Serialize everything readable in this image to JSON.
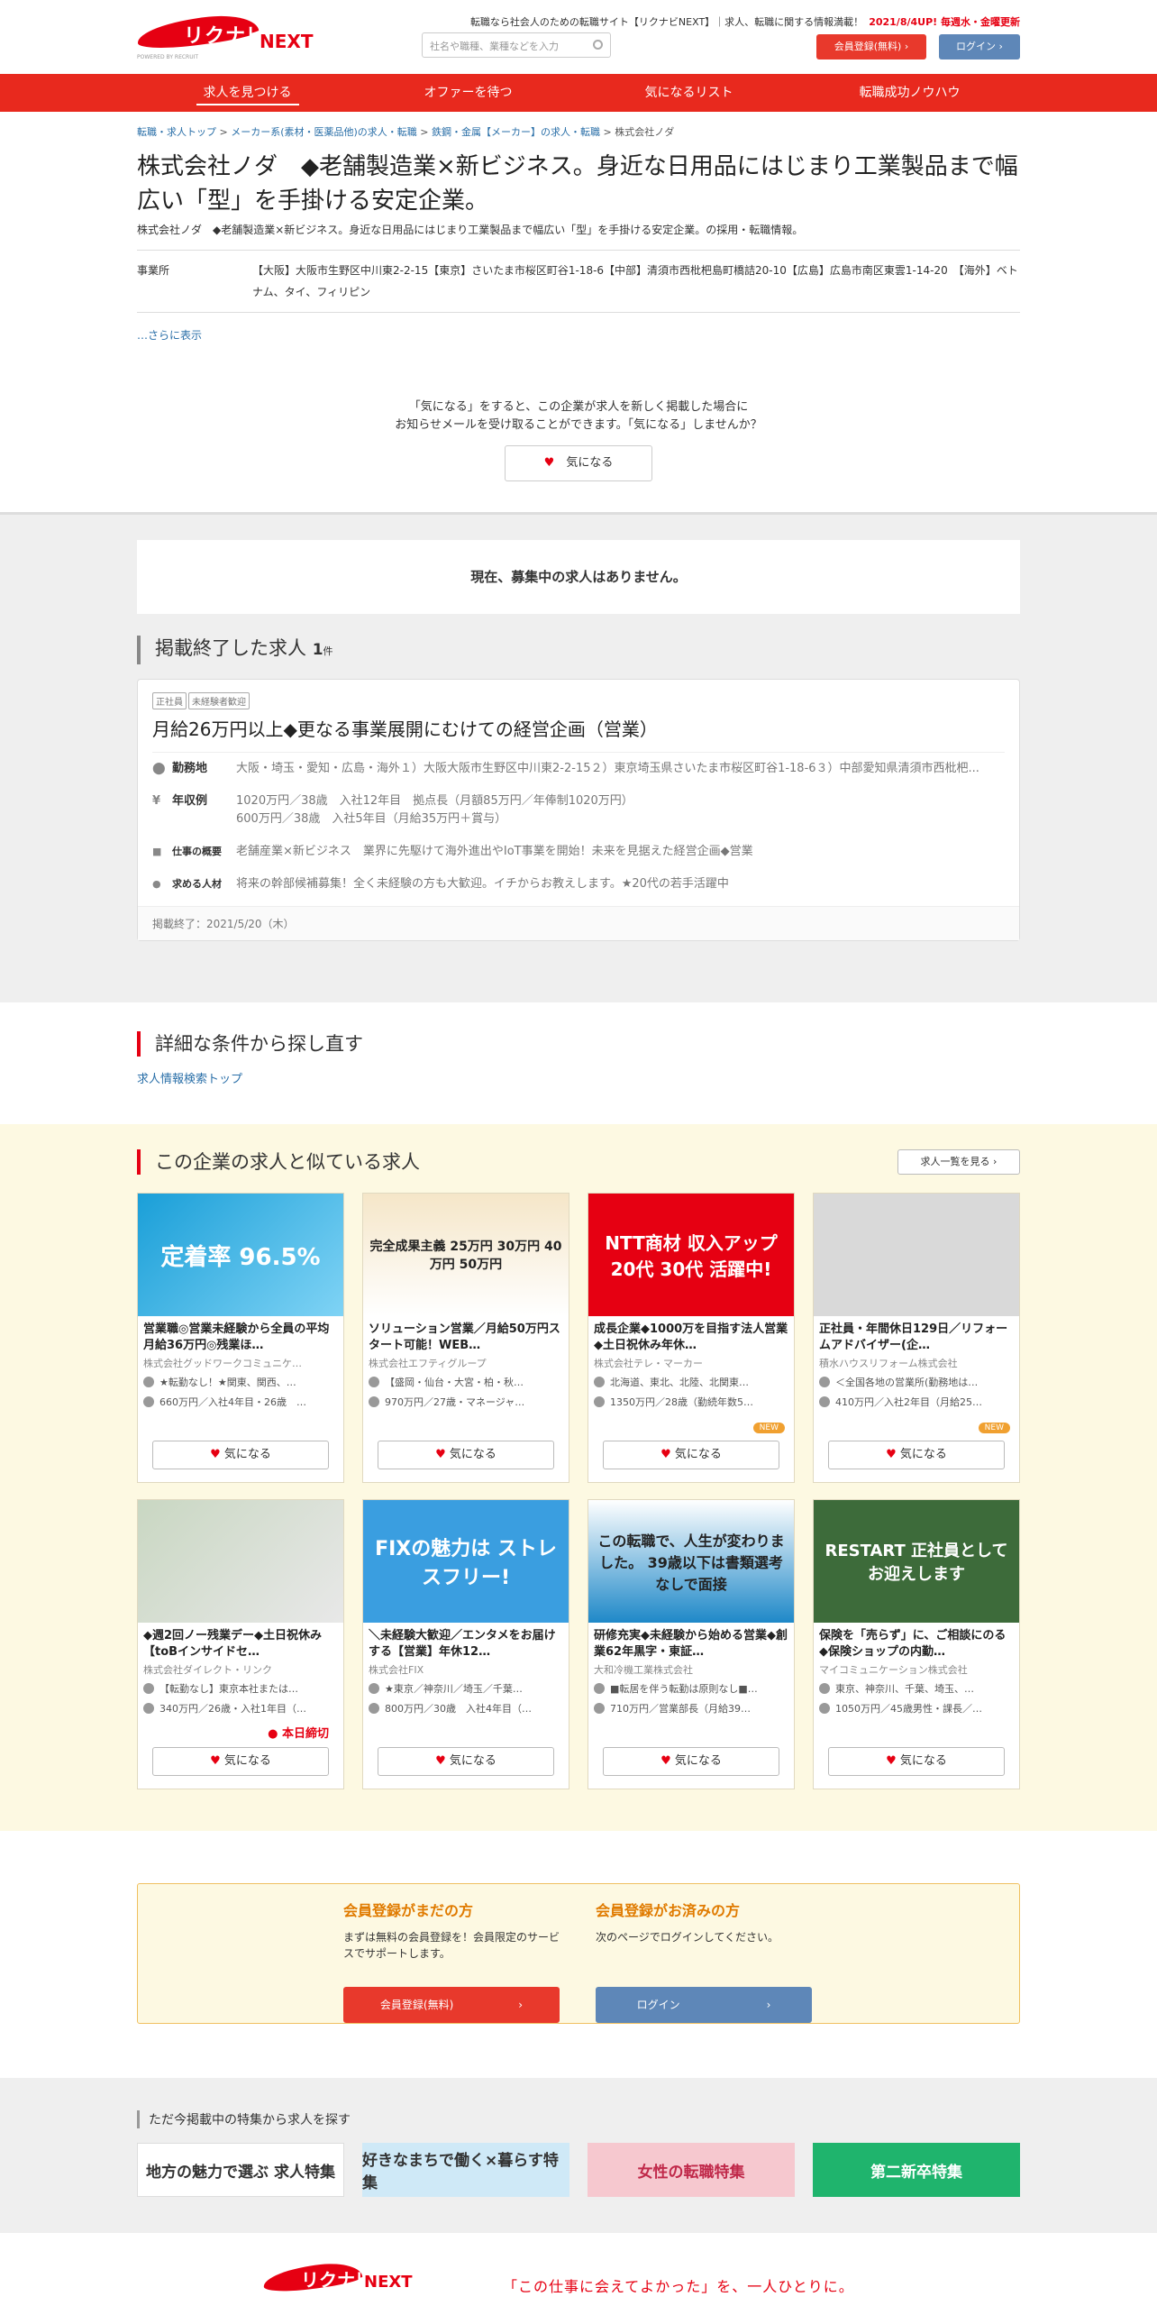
{
  "header": {
    "logo_main": "リクナビ",
    "logo_next": "NEXT",
    "powered": "POWERED BY RECRUIT",
    "tagline": "転職なら社会人のための転職サイト【リクナビNEXT】｜求人、転職に関する情報満載！",
    "update": "2021/8/4UP! 毎週水・金曜更新",
    "search_placeholder": "社名や職種、業種などを入力",
    "register": "会員登録(無料)",
    "login": "ログイン"
  },
  "nav": [
    "求人を見つける",
    "オファーを待つ",
    "気になるリスト",
    "転職成功ノウハウ"
  ],
  "breadcrumb": [
    "転職・求人トップ",
    "メーカー系(素材・医薬品他)の求人・転職",
    "鉄鋼・金属【メーカー】の求人・転職",
    "株式会社ノダ"
  ],
  "company": {
    "title": "株式会社ノダ　◆老舗製造業×新ビジネス。身近な日用品にはじまり工業製品まで幅広い「型」を手掛ける安定企業。",
    "subtitle": "株式会社ノダ　◆老舗製造業×新ビジネス。身近な日用品にはじまり工業製品まで幅広い「型」を手掛ける安定企業。の採用・転職情報。",
    "office_label": "事業所",
    "office": "【大阪】大阪市生野区中川東2-2-15【東京】さいたま市桜区町谷1-18-6【中部】清須市西枇杷島町橋詰20-10【広島】広島市南区東雲1-14-20　【海外】ベトナム、タイ、フィリピン",
    "more": "…さらに表示"
  },
  "follow": {
    "line1": "「気になる」をすると、この企業が求人を新しく掲載した場合に",
    "line2": "お知らせメールを受け取ることができます。「気になる」しませんか？",
    "button": "気になる"
  },
  "nojob": "現在、募集中の求人はありません。",
  "ended": {
    "heading": "掲載終了した求人",
    "count": "1",
    "unit": "件",
    "badges": [
      "正社員",
      "未経験者歓迎"
    ],
    "title": "月給26万円以上◆更なる事業展開にむけての経営企画（営業）",
    "rows": [
      {
        "label": "勤務地",
        "value": "大阪・埼玉・愛知・広島・海外１）大阪大阪市生野区中川東2-2-15２）東京埼玉県さいたま市桜区町谷1-18-6３）中部愛知県清須市西枇杷..."
      },
      {
        "label": "年収例",
        "value": "1020万円／38歳　入社12年目　拠点長（月額85万円／年俸制1020万円）\n600万円／38歳　入社5年目（月給35万円＋賞与）"
      },
      {
        "label": "仕事の概要",
        "value": "老舗産業×新ビジネス　業界に先駆けて海外進出やIoT事業を開始！未来を見据えた経営企画◆営業"
      },
      {
        "label": "求める人材",
        "value": "将来の幹部候補募集！全く未経験の方も大歓迎。イチからお教えします。★20代の若手活躍中"
      }
    ],
    "end": "掲載終了：2021/5/20（木）"
  },
  "detail": {
    "heading": "詳細な条件から探し直す",
    "link": "求人情報検索トップ"
  },
  "similar": {
    "heading": "この企業の求人と似ている求人",
    "all": "求人一覧を見る",
    "fav": "気になる",
    "jobs": [
      {
        "img": "定着率 96.5%",
        "title": "営業職◎営業未経験から全員の平均月給36万円◎残業ほ…",
        "company": "株式会社グッドワークコミュニケ…",
        "loc": "★転勤なし！★関東、関西、…",
        "sal": "660万円／入社4年目・26歳　…",
        "new": "",
        "tag": ""
      },
      {
        "img": "完全成果主義 25万円 30万円 40万円 50万円",
        "title": "ソリューション営業／月給50万円スタート可能！WEB…",
        "company": "株式会社エフティグループ",
        "loc": "【盛岡・仙台・大宮・柏・秋…",
        "sal": "970万円／27歳・マネージャ…",
        "new": "",
        "tag": ""
      },
      {
        "img": "NTT商材 収入アップ 20代 30代 活躍中!",
        "title": "成長企業◆1000万を目指す法人営業◆土日祝休み年休…",
        "company": "株式会社テレ・マーカー",
        "loc": "北海道、東北、北陸、北関東…",
        "sal": "1350万円／28歳（勤続年数5…",
        "new": "NEW",
        "tag": ""
      },
      {
        "img": "",
        "title": "正社員・年間休日129日／リフォームアドバイザー(企…",
        "company": "積水ハウスリフォーム株式会社",
        "loc": "＜全国各地の営業所(勤務地は…",
        "sal": "410万円／入社2年目（月給25…",
        "new": "NEW",
        "tag": ""
      },
      {
        "img": "",
        "title": "◆週2回ノー残業デー◆土日祝休み【toBインサイドセ…",
        "company": "株式会社ダイレクト・リンク",
        "loc": "【転勤なし】東京本社または…",
        "sal": "340万円／26歳・入社1年目（…",
        "new": "",
        "tag": "本日締切"
      },
      {
        "img": "FIXの魅力は ストレスフリー!",
        "title": "＼未経験大歓迎／エンタメをお届けする【営業】年休12…",
        "company": "株式会社FIX",
        "loc": "★東京／神奈川／埼玉／千葉…",
        "sal": "800万円／30歳　入社4年目（…",
        "new": "",
        "tag": ""
      },
      {
        "img": "この転職で、人生が変わりました。 39歳以下は書類選考なしで面接",
        "title": "研修充実◆未経験から始める営業◆創業62年黒字・東証…",
        "company": "大和冷機工業株式会社",
        "loc": "■転居を伴う転勤は原則なし■…",
        "sal": "710万円／営業部長（月給39…",
        "new": "",
        "tag": ""
      },
      {
        "img": "RESTART 正社員としてお迎えします",
        "title": "保険を「売らず」に、ご相談にのる◆保険ショップの内勤…",
        "company": "マイコミュニケーション株式会社",
        "loc": "東京、神奈川、千葉、埼玉、…",
        "sal": "1050万円／45歳男性・課長／…",
        "new": "",
        "tag": ""
      }
    ]
  },
  "member": {
    "h1": "会員登録がまだの方",
    "p1": "まずは無料の会員登録を！会員限定のサービスでサポートします。",
    "b1": "会員登録(無料)",
    "h2": "会員登録がお済みの方",
    "p2": "次のページでログインしてください。",
    "b2": "ログイン"
  },
  "feature": {
    "heading": "ただ今掲載中の特集から求人を探す",
    "banners": [
      "地方の魅力で選ぶ 求人特集",
      "好きなまちで働く×暮らす特集",
      "女性の転職特集",
      "第二新卒特集"
    ]
  },
  "footer": {
    "tagline": "「この仕事に会えてよかった」を、一人ひとりに。"
  },
  "colors": {
    "brand_red": "#e60012",
    "nav_red": "#e8291e",
    "login_blue": "#5e87b8",
    "similar_bg": "#fdf9e2"
  }
}
